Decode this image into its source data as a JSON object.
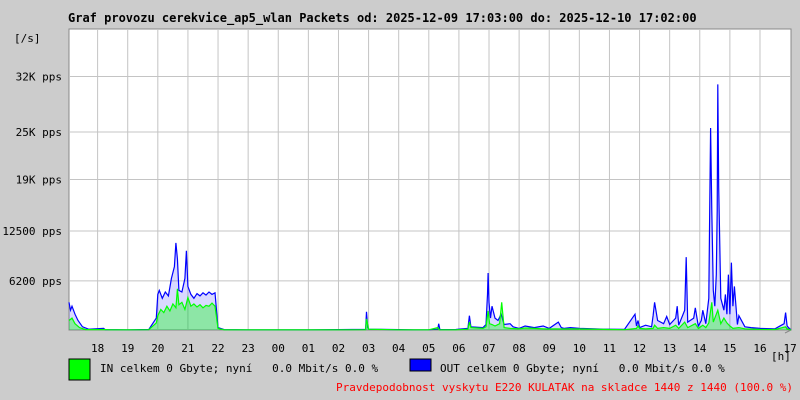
{
  "chart_data": {
    "type": "area",
    "title": "Graf provozu cerekvice_ap5_wlan Packets od: 2025-12-09 17:03:00 do: 2025-12-10 17:02:00",
    "ylabel": "[/s]",
    "xlabel": "[h]",
    "y_ticks": [
      {
        "value": 6200,
        "label": "6200 pps"
      },
      {
        "value": 12500,
        "label": "12500 pps"
      },
      {
        "value": 19000,
        "label": "19K pps"
      },
      {
        "value": 25000,
        "label": "25K pps"
      },
      {
        "value": 32000,
        "label": "32K pps"
      }
    ],
    "ylim": [
      0,
      38000
    ],
    "xlim": [
      17.05,
      41.03
    ],
    "x_tick_labels": [
      "18",
      "19",
      "20",
      "21",
      "22",
      "23",
      "00",
      "01",
      "02",
      "03",
      "04",
      "05",
      "06",
      "07",
      "08",
      "09",
      "10",
      "11",
      "12",
      "13",
      "14",
      "15",
      "16",
      "17"
    ],
    "grid": true,
    "series": [
      {
        "name": "IN",
        "color": "#00ff00",
        "points": [
          [
            17.05,
            1200
          ],
          [
            17.15,
            1500
          ],
          [
            17.25,
            800
          ],
          [
            17.4,
            300
          ],
          [
            17.6,
            50
          ],
          [
            18.2,
            60
          ],
          [
            18.4,
            30
          ],
          [
            19.0,
            20
          ],
          [
            19.7,
            40
          ],
          [
            19.95,
            900
          ],
          [
            20.0,
            1800
          ],
          [
            20.1,
            2600
          ],
          [
            20.2,
            2200
          ],
          [
            20.3,
            3000
          ],
          [
            20.4,
            2400
          ],
          [
            20.5,
            3300
          ],
          [
            20.6,
            2800
          ],
          [
            20.65,
            5200
          ],
          [
            20.7,
            3200
          ],
          [
            20.8,
            3500
          ],
          [
            20.9,
            2600
          ],
          [
            21.0,
            4100
          ],
          [
            21.1,
            3000
          ],
          [
            21.2,
            3300
          ],
          [
            21.3,
            2900
          ],
          [
            21.4,
            3200
          ],
          [
            21.5,
            2800
          ],
          [
            21.6,
            3100
          ],
          [
            21.7,
            3000
          ],
          [
            21.8,
            3400
          ],
          [
            21.9,
            3000
          ],
          [
            22.0,
            200
          ],
          [
            22.2,
            30
          ],
          [
            23.0,
            20
          ],
          [
            24.0,
            20
          ],
          [
            25.0,
            20
          ],
          [
            26.0,
            30
          ],
          [
            26.9,
            40
          ],
          [
            26.93,
            1400
          ],
          [
            27.0,
            100
          ],
          [
            28.0,
            30
          ],
          [
            28.5,
            20
          ],
          [
            29.0,
            30
          ],
          [
            29.3,
            300
          ],
          [
            29.35,
            20
          ],
          [
            29.9,
            30
          ],
          [
            30.3,
            100
          ],
          [
            30.35,
            1000
          ],
          [
            30.4,
            300
          ],
          [
            30.8,
            200
          ],
          [
            30.9,
            400
          ],
          [
            30.97,
            2400
          ],
          [
            31.02,
            800
          ],
          [
            31.1,
            700
          ],
          [
            31.2,
            500
          ],
          [
            31.35,
            800
          ],
          [
            31.42,
            3500
          ],
          [
            31.5,
            300
          ],
          [
            31.7,
            200
          ],
          [
            32.0,
            150
          ],
          [
            32.2,
            250
          ],
          [
            32.5,
            200
          ],
          [
            32.8,
            150
          ],
          [
            33.0,
            120
          ],
          [
            33.2,
            150
          ],
          [
            33.5,
            120
          ],
          [
            33.7,
            150
          ],
          [
            34.0,
            120
          ],
          [
            34.5,
            100
          ],
          [
            34.8,
            80
          ],
          [
            35.0,
            60
          ],
          [
            35.5,
            40
          ],
          [
            35.9,
            200
          ],
          [
            35.95,
            500
          ],
          [
            36.0,
            200
          ],
          [
            36.2,
            150
          ],
          [
            36.45,
            200
          ],
          [
            36.5,
            600
          ],
          [
            36.6,
            200
          ],
          [
            36.8,
            300
          ],
          [
            37.0,
            200
          ],
          [
            37.2,
            600
          ],
          [
            37.3,
            200
          ],
          [
            37.5,
            1000
          ],
          [
            37.6,
            300
          ],
          [
            37.85,
            800
          ],
          [
            37.95,
            200
          ],
          [
            38.1,
            600
          ],
          [
            38.2,
            300
          ],
          [
            38.3,
            900
          ],
          [
            38.4,
            3500
          ],
          [
            38.45,
            1000
          ],
          [
            38.6,
            2500
          ],
          [
            38.7,
            800
          ],
          [
            38.8,
            1500
          ],
          [
            38.9,
            900
          ],
          [
            39.0,
            500
          ],
          [
            39.1,
            200
          ],
          [
            39.3,
            300
          ],
          [
            39.5,
            150
          ],
          [
            40.0,
            80
          ],
          [
            40.5,
            60
          ],
          [
            40.85,
            400
          ],
          [
            40.9,
            100
          ],
          [
            41.03,
            30
          ]
        ]
      },
      {
        "name": "OUT",
        "color": "#0000ff",
        "points": [
          [
            17.05,
            3500
          ],
          [
            17.1,
            2500
          ],
          [
            17.15,
            3000
          ],
          [
            17.25,
            2000
          ],
          [
            17.35,
            1200
          ],
          [
            17.5,
            400
          ],
          [
            17.7,
            100
          ],
          [
            18.2,
            200
          ],
          [
            18.25,
            50
          ],
          [
            19.0,
            30
          ],
          [
            19.7,
            60
          ],
          [
            19.95,
            1500
          ],
          [
            20.0,
            4500
          ],
          [
            20.05,
            5000
          ],
          [
            20.15,
            4000
          ],
          [
            20.25,
            4800
          ],
          [
            20.35,
            4300
          ],
          [
            20.45,
            6500
          ],
          [
            20.55,
            8000
          ],
          [
            20.6,
            11000
          ],
          [
            20.65,
            9000
          ],
          [
            20.7,
            5000
          ],
          [
            20.8,
            4800
          ],
          [
            20.9,
            6500
          ],
          [
            20.95,
            10000
          ],
          [
            21.0,
            5500
          ],
          [
            21.1,
            4500
          ],
          [
            21.2,
            4000
          ],
          [
            21.3,
            4600
          ],
          [
            21.4,
            4300
          ],
          [
            21.5,
            4700
          ],
          [
            21.6,
            4400
          ],
          [
            21.7,
            4800
          ],
          [
            21.8,
            4500
          ],
          [
            21.9,
            4700
          ],
          [
            22.0,
            300
          ],
          [
            22.2,
            50
          ],
          [
            23.0,
            30
          ],
          [
            24.0,
            30
          ],
          [
            25.0,
            30
          ],
          [
            26.0,
            50
          ],
          [
            26.9,
            80
          ],
          [
            26.93,
            2300
          ],
          [
            26.97,
            300
          ],
          [
            27.0,
            100
          ],
          [
            28.0,
            50
          ],
          [
            28.5,
            30
          ],
          [
            29.0,
            40
          ],
          [
            29.3,
            100
          ],
          [
            29.33,
            800
          ],
          [
            29.37,
            50
          ],
          [
            29.9,
            60
          ],
          [
            30.3,
            200
          ],
          [
            30.35,
            1800
          ],
          [
            30.4,
            400
          ],
          [
            30.8,
            300
          ],
          [
            30.9,
            700
          ],
          [
            30.95,
            4500
          ],
          [
            30.97,
            7200
          ],
          [
            31.0,
            3500
          ],
          [
            31.05,
            1500
          ],
          [
            31.1,
            3000
          ],
          [
            31.2,
            1500
          ],
          [
            31.3,
            1200
          ],
          [
            31.4,
            2000
          ],
          [
            31.5,
            700
          ],
          [
            31.7,
            800
          ],
          [
            31.8,
            400
          ],
          [
            32.0,
            200
          ],
          [
            32.2,
            500
          ],
          [
            32.5,
            300
          ],
          [
            32.8,
            500
          ],
          [
            33.0,
            200
          ],
          [
            33.3,
            1000
          ],
          [
            33.4,
            300
          ],
          [
            33.5,
            200
          ],
          [
            33.7,
            300
          ],
          [
            34.0,
            200
          ],
          [
            34.5,
            150
          ],
          [
            34.8,
            100
          ],
          [
            35.0,
            100
          ],
          [
            35.5,
            80
          ],
          [
            35.85,
            2000
          ],
          [
            35.9,
            500
          ],
          [
            35.95,
            1200
          ],
          [
            36.0,
            300
          ],
          [
            36.2,
            600
          ],
          [
            36.4,
            400
          ],
          [
            36.45,
            1800
          ],
          [
            36.5,
            3500
          ],
          [
            36.6,
            1200
          ],
          [
            36.8,
            800
          ],
          [
            36.9,
            1700
          ],
          [
            37.0,
            700
          ],
          [
            37.2,
            1500
          ],
          [
            37.25,
            3000
          ],
          [
            37.3,
            600
          ],
          [
            37.5,
            2500
          ],
          [
            37.55,
            9200
          ],
          [
            37.6,
            1000
          ],
          [
            37.8,
            1500
          ],
          [
            37.85,
            2800
          ],
          [
            37.95,
            500
          ],
          [
            38.05,
            1200
          ],
          [
            38.1,
            2500
          ],
          [
            38.2,
            800
          ],
          [
            38.3,
            4000
          ],
          [
            38.33,
            15000
          ],
          [
            38.36,
            25500
          ],
          [
            38.4,
            15000
          ],
          [
            38.45,
            5000
          ],
          [
            38.5,
            3000
          ],
          [
            38.55,
            7000
          ],
          [
            38.58,
            15000
          ],
          [
            38.6,
            31000
          ],
          [
            38.63,
            18000
          ],
          [
            38.7,
            4000
          ],
          [
            38.8,
            2500
          ],
          [
            38.85,
            4500
          ],
          [
            38.9,
            2000
          ],
          [
            38.95,
            7000
          ],
          [
            39.0,
            2000
          ],
          [
            39.05,
            8500
          ],
          [
            39.1,
            3000
          ],
          [
            39.15,
            5500
          ],
          [
            39.25,
            700
          ],
          [
            39.3,
            1800
          ],
          [
            39.5,
            400
          ],
          [
            39.7,
            300
          ],
          [
            40.0,
            200
          ],
          [
            40.5,
            150
          ],
          [
            40.8,
            800
          ],
          [
            40.85,
            2200
          ],
          [
            40.9,
            500
          ],
          [
            41.0,
            100
          ],
          [
            41.03,
            50
          ]
        ]
      }
    ]
  },
  "legend": {
    "in_text": "IN celkem 0 Gbyte; nyní   0.0 Mbit/s 0.0 %",
    "out_text": "OUT celkem 0 Gbyte; nyní   0.0 Mbit/s 0.0 %",
    "in_color": "#00ff00",
    "out_color": "#0000ff"
  },
  "footer": {
    "note": "Pravdepodobnost vyskytu E220 KULATAK na skladce 1440 z 1440 (100.0 %)",
    "note_color": "#ff0000"
  }
}
